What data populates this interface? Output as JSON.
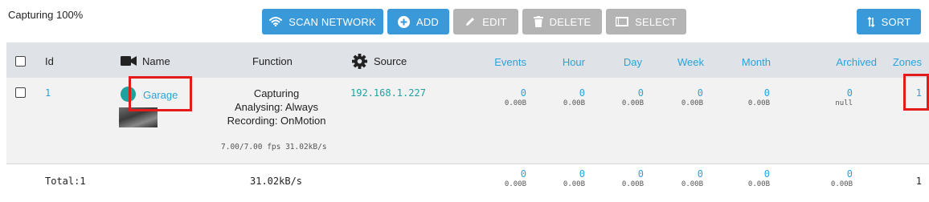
{
  "status": "Capturing 100%",
  "toolbar": {
    "scan_network": "SCAN NETWORK",
    "add": "ADD",
    "edit": "EDIT",
    "delete": "DELETE",
    "select": "SELECT",
    "sort": "SORT"
  },
  "table": {
    "headers": {
      "id": "Id",
      "name": "Name",
      "function": "Function",
      "source": "Source",
      "events": "Events",
      "hour": "Hour",
      "day": "Day",
      "week": "Week",
      "month": "Month",
      "archived": "Archived",
      "zones": "Zones"
    },
    "row": {
      "id": "1",
      "name": "Garage",
      "function_line1": "Capturing",
      "function_line2": "Analysing: Always",
      "function_line3": "Recording: OnMotion",
      "fps": "7.00/7.00 fps 31.02kB/s",
      "source": "192.168.1.227",
      "events": {
        "count": "0",
        "size": "0.00B"
      },
      "hour": {
        "count": "0",
        "size": "0.00B"
      },
      "day": {
        "count": "0",
        "size": "0.00B"
      },
      "week": {
        "count": "0",
        "size": "0.00B"
      },
      "month": {
        "count": "0",
        "size": "0.00B"
      },
      "archived": {
        "count": "0",
        "size": "null"
      },
      "zones": "1"
    },
    "totals": {
      "label": "Total:1",
      "bandwidth": "31.02kB/s",
      "events": {
        "count": "0",
        "size": "0.00B"
      },
      "hour": {
        "count": "0",
        "size": "0.00B"
      },
      "day": {
        "count": "0",
        "size": "0.00B"
      },
      "week": {
        "count": "0",
        "size": "0.00B"
      },
      "month": {
        "count": "0",
        "size": "0.00B"
      },
      "archived": {
        "count": "0",
        "size": "0.00B"
      },
      "zones": "1"
    }
  },
  "colors": {
    "primary": "#3a9ad9",
    "disabled": "#b4b4b4",
    "link": "#2aa3dc",
    "status_dot": "#1ea2a0",
    "highlight": "#e31b1b"
  }
}
